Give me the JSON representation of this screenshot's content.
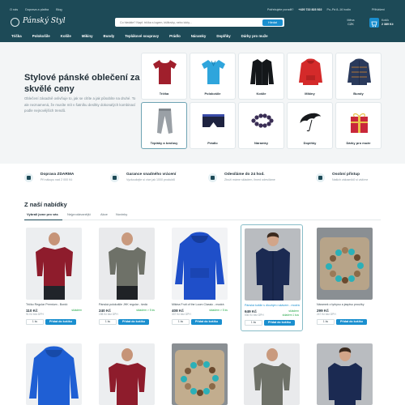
{
  "header": {
    "top_links": [
      "O nás",
      "Doprava a platba",
      "Blog"
    ],
    "logo_text": "Pánský Styl",
    "search_placeholder": "Co hledáte? Např. trička s logem, kšiltovky, nebo lokty...",
    "search_button": "Hledat",
    "contact_label": "Potřebujete poradit?",
    "phone": "+420 722 823 922",
    "hours": "Po–Pá 8–16 hodin",
    "login": "Přihlášení",
    "currency_label": "Měna",
    "currency_value": "CZK",
    "cart_label": "Košík",
    "cart_total": "2 389 Kč",
    "nav": [
      "Trička",
      "Polokošile",
      "Košile",
      "Mikiny",
      "Bundy",
      "Teplákové soupravy",
      "Prádlo",
      "Náramky",
      "Doplňky",
      "Dárky pro muže"
    ]
  },
  "hero": {
    "title": "Stylové pánské oblečení za skvělé ceny",
    "text": "Oblečení zásadně ovlivňuje to, jak se cítíte a jak působíte na druhé. To ale neznamená, že musíte mít v šatníku desítky dokonalých kombinací podle nejnovějších trendů.",
    "categories": [
      {
        "label": "Trička",
        "icon": "tshirt-icon",
        "color": "#a01f2c"
      },
      {
        "label": "Polokošile",
        "icon": "polo-icon",
        "color": "#2fa5dc"
      },
      {
        "label": "Košile",
        "icon": "shirt-icon",
        "color": "#14171a"
      },
      {
        "label": "Mikiny",
        "icon": "hoodie-icon",
        "color": "#d42a2a"
      },
      {
        "label": "Bundy",
        "icon": "jacket-icon",
        "color": "#2a3a5c"
      },
      {
        "label": "Tepláky a kraťasy",
        "icon": "sweatpants-icon",
        "color": "#9aa0a6"
      },
      {
        "label": "Prádlo",
        "icon": "underwear-icon",
        "color": "#1e2340"
      },
      {
        "label": "Náramky",
        "icon": "bracelet-icon",
        "color": "#3a2e55"
      },
      {
        "label": "Doplňky",
        "icon": "umbrella-icon",
        "color": "#17191c"
      },
      {
        "label": "Dárky pro muže",
        "icon": "gift-icon",
        "color": "#c9273a"
      }
    ]
  },
  "benefits": [
    {
      "title": "Doprava ZDARMA",
      "sub": "Při nákupu nad 2 000 Kč"
    },
    {
      "title": "Garance snadného vrácení",
      "sub": "Vyzkoušejte si více jak 1000 produktů"
    },
    {
      "title": "Odesíláme do 24 hod.",
      "sub": "Zboží máme skladem, ihned odesíláme"
    },
    {
      "title": "Osobní přístup",
      "sub": "Našich zákazníků si vážíme"
    }
  ],
  "offers": {
    "title": "Z naší nabídky",
    "tabs": [
      "Vybrali jsme pro vás",
      "Nejprodávanější",
      "Akce",
      "Novinky"
    ],
    "products": [
      {
        "name": "Tričko Regular Premium - Bordó",
        "price": "110 Kč",
        "vat": "91 Kč bez DPH",
        "stock": "skladem",
        "avail": "",
        "qty": "1 ks",
        "cta": "Přidat do košíku"
      },
      {
        "name": "Pánská polokošile JHK regular - šedá",
        "price": "240 Kč",
        "vat": "198 Kč bez DPH",
        "stock": "skladem > 5 ks",
        "avail": "",
        "qty": "1 ks",
        "cta": "Přidat do košíku"
      },
      {
        "name": "Mikina Fruit of the Loom Classic - modrá",
        "price": "408 Kč",
        "vat": "337 Kč bez DPH",
        "stock": "skladem > 5 ks",
        "avail": "",
        "qty": "1 ks",
        "cta": "Přidat do košíku"
      },
      {
        "name": "Pánská košile s dlouhým rukávem - modrá",
        "price": "649 Kč",
        "vat": "536 Kč bez DPH",
        "stock": "skladem",
        "avail": "skladem 1 kus",
        "qty": "1 ks",
        "cta": "Přidat do košíku"
      },
      {
        "name": "Náramek z tyrkysu a jaspisu proužky",
        "price": "299 Kč",
        "vat": "247 Kč bez DPH",
        "stock": "",
        "avail": "",
        "qty": "1 ks",
        "cta": "Přidat do košíku"
      }
    ]
  }
}
